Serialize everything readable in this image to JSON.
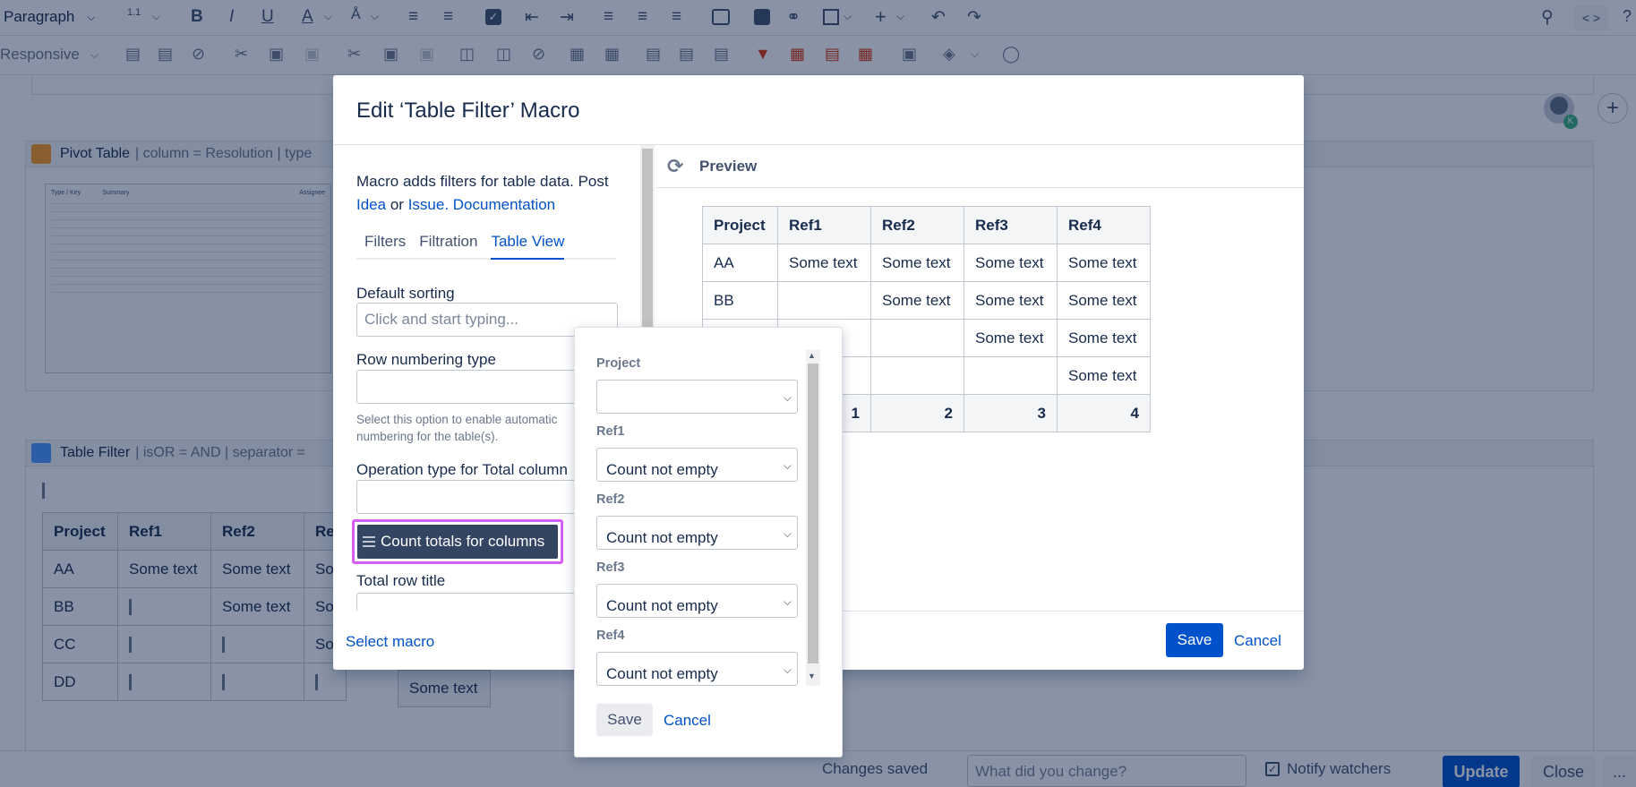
{
  "toolbar": {
    "paragraph": "Paragraph",
    "line_height": "1.1",
    "code": "< >",
    "help": "?",
    "responsive": "Responsive"
  },
  "editor": {
    "pivot_title": "Pivot Table",
    "pivot_params": "| column = Resolution | type",
    "filter_title": "Table Filter",
    "filter_params": "| isOR = AND | separator =",
    "avatar_badge": "K",
    "thumb_headers": [
      "Type / Key",
      "Summary",
      "Assignee"
    ],
    "table": {
      "headers": [
        "Project",
        "Ref1",
        "Ref2",
        "Re"
      ],
      "rows": [
        [
          "AA",
          "Some text",
          "Some text",
          "So"
        ],
        [
          "BB",
          "",
          "Some text",
          "So"
        ],
        [
          "CC",
          "",
          "",
          "So"
        ],
        [
          "DD",
          "",
          "",
          ""
        ]
      ],
      "extra_cell": "Some text"
    }
  },
  "footer": {
    "changes_saved": "Changes saved",
    "change_placeholder": "What did you change?",
    "notify": "Notify watchers",
    "update": "Update",
    "close": "Close",
    "more": "..."
  },
  "modal": {
    "title": "Edit ‘Table Filter’ Macro",
    "desc_prefix": "Macro adds filters for table data. Post",
    "link_idea": "Idea",
    "desc_or": "or",
    "link_issue": "Issue.",
    "link_docs": "Documentation",
    "tabs": [
      "Filters",
      "Filtration",
      "Table View"
    ],
    "default_sorting_label": "Default sorting",
    "default_sorting_placeholder": "Click and start typing...",
    "row_numbering_label": "Row numbering type",
    "row_numbering_help": "Select this option to enable automatic numbering for the table(s).",
    "operation_label": "Operation type for Total column",
    "count_totals": "Count totals for columns",
    "total_row_label": "Total row title",
    "preview": "Preview",
    "select_macro": "Select macro",
    "save": "Save",
    "cancel": "Cancel"
  },
  "preview_table": {
    "headers": [
      "Project",
      "Ref1",
      "Ref2",
      "Ref3",
      "Ref4"
    ],
    "rows": [
      [
        "AA",
        "Some text",
        "Some text",
        "Some text",
        "Some text"
      ],
      [
        "BB",
        "",
        "Some text",
        "Some text",
        "Some text"
      ],
      [
        "",
        "",
        "",
        "Some text",
        "Some text"
      ],
      [
        "",
        "",
        "",
        "",
        "Some text"
      ]
    ],
    "totals": [
      "",
      "1",
      "2",
      "3",
      "4"
    ]
  },
  "popup": {
    "fields": [
      {
        "label": "Project",
        "value": ""
      },
      {
        "label": "Ref1",
        "value": "Count not empty"
      },
      {
        "label": "Ref2",
        "value": "Count not empty"
      },
      {
        "label": "Ref3",
        "value": "Count not empty"
      },
      {
        "label": "Ref4",
        "value": "Count not empty"
      }
    ],
    "save": "Save",
    "cancel": "Cancel"
  }
}
